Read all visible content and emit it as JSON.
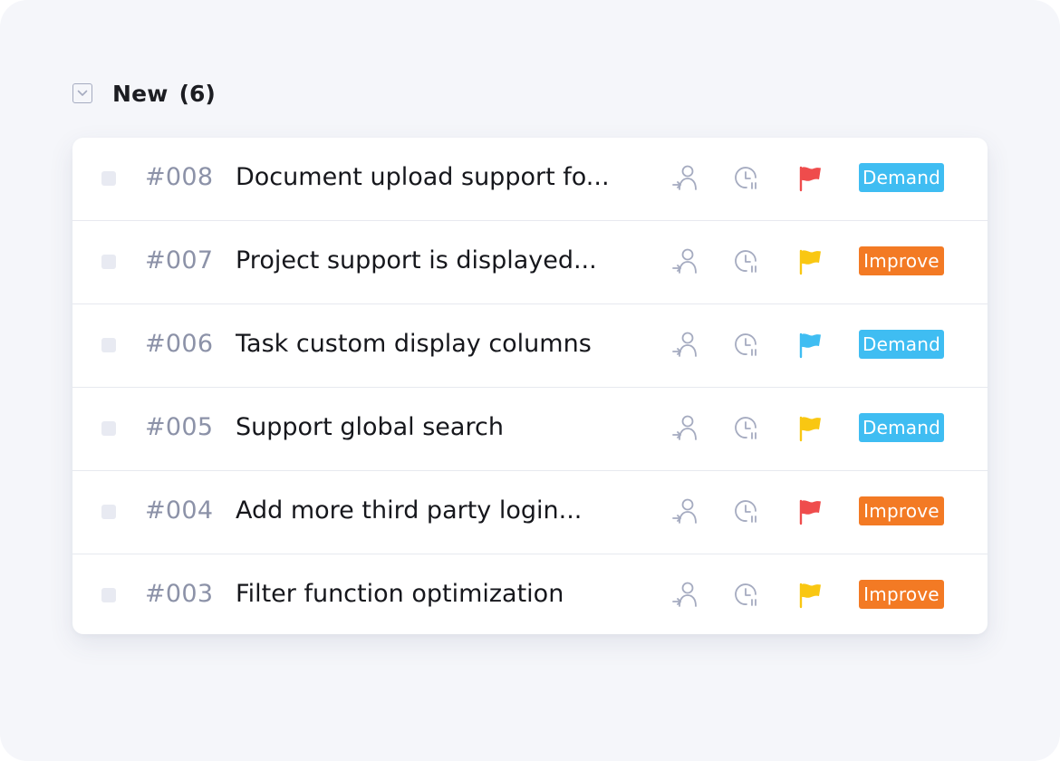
{
  "group": {
    "title": "New",
    "count": "(6)"
  },
  "colors": {
    "background": "#f5f6fa",
    "card": "#ffffff",
    "id_text": "#8c92a8",
    "title_text": "#16171c",
    "icon_gray": "#a5abc0"
  },
  "tag_colors": {
    "Demand": "#3fbdf2",
    "Improve": "#f37a24"
  },
  "flag_colors": {
    "red": "#ef4c4c",
    "yellow": "#f9c712",
    "blue": "#3fbdf2"
  },
  "tasks": [
    {
      "id": "#008",
      "title": "Document upload support fo...",
      "flag": "red",
      "tag": "Demand"
    },
    {
      "id": "#007",
      "title": "Project support is displayed...",
      "flag": "yellow",
      "tag": "Improve"
    },
    {
      "id": "#006",
      "title": "Task custom display columns",
      "flag": "blue",
      "tag": "Demand"
    },
    {
      "id": "#005",
      "title": "Support global search",
      "flag": "yellow",
      "tag": "Demand"
    },
    {
      "id": "#004",
      "title": "Add more third party login...",
      "flag": "red",
      "tag": "Improve"
    },
    {
      "id": "#003",
      "title": "Filter function optimization",
      "flag": "yellow",
      "tag": "Improve"
    }
  ],
  "icons": {
    "collapse": "chevron-down-icon",
    "assignee": "assign-user-icon",
    "time": "clock-icon",
    "priority": "flag-icon"
  }
}
